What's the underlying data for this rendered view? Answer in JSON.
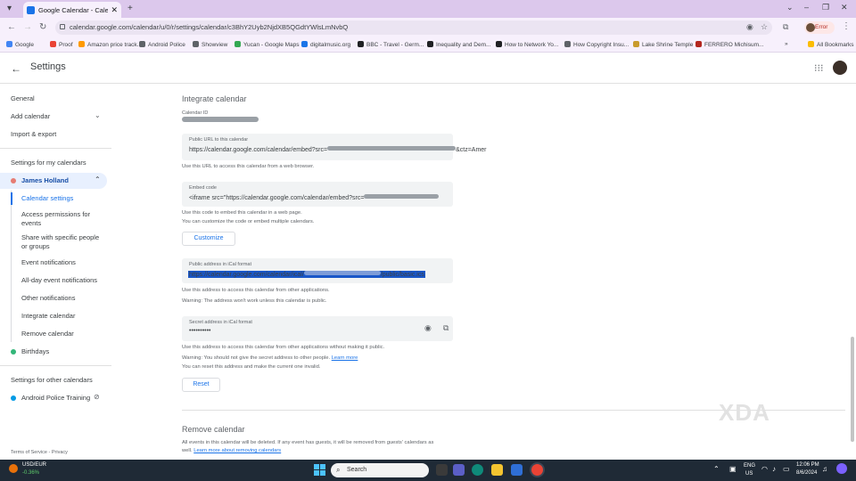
{
  "browser": {
    "tab_title": "Google Calendar - Calendar se",
    "tab_close": "✕",
    "new_tab": "+",
    "url": "calendar.google.com/calendar/u/0/r/settings/calendar/c3BhY2Uyb2NjdXB5QGdtYWlsLmNvbQ",
    "profile_label": "Error",
    "window_controls": [
      "⌄",
      "–",
      "❐",
      "✕"
    ],
    "nav": [
      "←",
      "→",
      "↻"
    ],
    "bookmarks": [
      {
        "label": "Google",
        "color": "#4285f4"
      },
      {
        "label": "Proof",
        "color": "#ea4335"
      },
      {
        "label": "Amazon price track...",
        "color": "#ff9900"
      },
      {
        "label": "Android Police",
        "color": "#5f6368"
      },
      {
        "label": "Showview",
        "color": "#5f6368"
      },
      {
        "label": "Yucan - Google Maps",
        "color": "#34a853"
      },
      {
        "label": "digitalmusic.org",
        "color": "#1a73e8"
      },
      {
        "label": "BBC - Travel - Germ...",
        "color": "#202124"
      },
      {
        "label": "Inequality and Dem...",
        "color": "#202124"
      },
      {
        "label": "How to Network Yo...",
        "color": "#202124"
      },
      {
        "label": "How Copyright Insu...",
        "color": "#5f6368"
      },
      {
        "label": "Lake Shrine Temple",
        "color": "#c99b2e"
      },
      {
        "label": "FERRERO Michisum...",
        "color": "#b3261e"
      }
    ],
    "all_bookmarks": "All Bookmarks"
  },
  "header": {
    "title": "Settings",
    "back": "←",
    "apps": "⋮⋮⋮"
  },
  "sidebar": {
    "top_items": [
      "General",
      "Add calendar",
      "Import & export"
    ],
    "my_calendars_heading": "Settings for my calendars",
    "active_calendar": {
      "label": "James Holland",
      "color": "#e67c73"
    },
    "sub_items": [
      "Calendar settings",
      "Access permissions for events",
      "Share with specific people or groups",
      "Event notifications",
      "All-day event notifications",
      "Other notifications",
      "Integrate calendar",
      "Remove calendar"
    ],
    "birthdays": {
      "label": "Birthdays",
      "color": "#33b679"
    },
    "other_calendars_heading": "Settings for other calendars",
    "other_calendar": {
      "label": "Android Police Training",
      "color": "#039be5"
    },
    "footer": "Terms of Service - Privacy"
  },
  "integrate": {
    "heading": "Integrate calendar",
    "calendar_id_label": "Calendar ID",
    "public_url_label": "Public URL to this calendar",
    "public_url_prefix": "https://calendar.google.com/calendar/embed?src=",
    "public_url_suffix": "&ctz=Amer",
    "public_url_note": "Use this URL to access this calendar from a web browser.",
    "embed_label": "Embed code",
    "embed_prefix": "<iframe src=\"https://calendar.google.com/calendar/embed?src=",
    "embed_note1": "Use this code to embed this calendar in a web page.",
    "embed_note2": "You can customize the code or embed multiple calendars.",
    "customize": "Customize",
    "ical_label": "Public address in iCal format",
    "ical_prefix": "https://calendar.google.com/calendar/ical/",
    "ical_suffix": "/public/basic.ics",
    "ical_note1": "Use this address to access this calendar from other applications.",
    "ical_note2": "Warning: The address won't work unless this calendar is public.",
    "secret_label": "Secret address in iCal format",
    "secret_value": "••••••••••",
    "secret_note1": "Use this address to access this calendar from other applications without making it public.",
    "secret_note2": "Warning: You should not give the secret address to other people.",
    "learn_more": "Learn more",
    "secret_note3": "You can reset this address and make the current one invalid.",
    "reset": "Reset"
  },
  "remove": {
    "heading": "Remove calendar",
    "note_line1": "All events in this calendar will be deleted. If any event has guests, it will be removed from guests' calendars as",
    "note_prefix": "well.",
    "note_link": "Learn more about removing calendars"
  },
  "watermark": "XDA",
  "taskbar": {
    "ticker": "USD/EUR",
    "ticker_change": "-0.36%",
    "search_placeholder": "Search",
    "lang": "ENG",
    "region": "US",
    "time": "12:06 PM",
    "date": "8/6/2024"
  }
}
